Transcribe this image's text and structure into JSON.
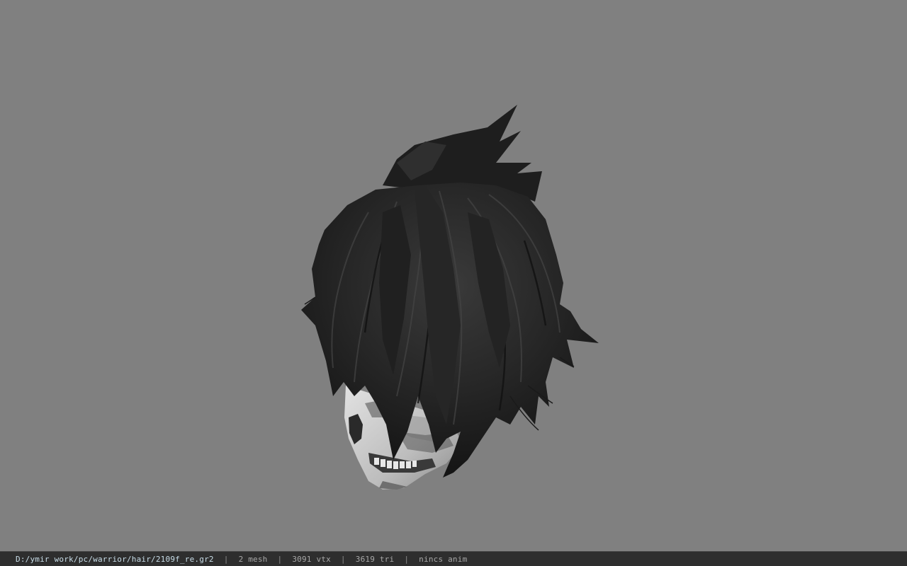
{
  "viewport": {
    "background": "#808080",
    "model": {
      "name": "hair-with-skull-mask",
      "colors": {
        "hair_dark": "#1a1a1a",
        "hair_mid": "#2c2c2c",
        "hair_light": "#3d3d3d",
        "mask_light": "#d6d6d6",
        "mask_shadow": "#4a4a4a"
      }
    }
  },
  "status_bar": {
    "file_path": "D:/ymir work/pc/warrior/hair/2109f_re.gr2",
    "separator": "|",
    "mesh_count": "2 mesh",
    "vertex_count": "3091 vtx",
    "triangle_count": "3619 tri",
    "anim_status": "nincs anim"
  }
}
